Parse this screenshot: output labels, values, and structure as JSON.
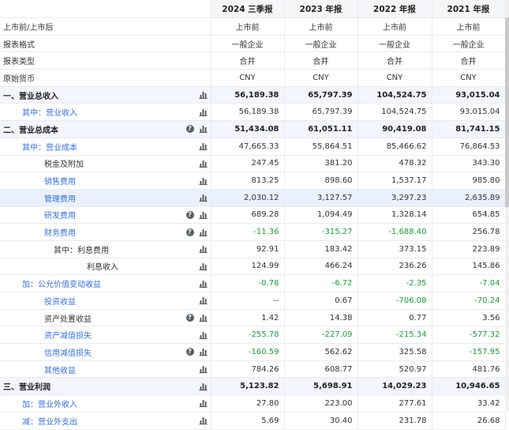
{
  "columns": [
    "2024 三季报",
    "2023 年报",
    "2022 年报",
    "2021 年报"
  ],
  "rows": [
    {
      "label": "上市前/上市后",
      "values": [
        "上市前",
        "上市前",
        "上市前",
        "上市前"
      ],
      "kind": "meta"
    },
    {
      "label": "报表格式",
      "values": [
        "一般企业",
        "一般企业",
        "一般企业",
        "一般企业"
      ],
      "kind": "meta"
    },
    {
      "label": "报表类型",
      "values": [
        "合并",
        "合并",
        "合并",
        "合并"
      ],
      "kind": "meta"
    },
    {
      "label": "原始货币",
      "values": [
        "CNY",
        "CNY",
        "CNY",
        "CNY"
      ],
      "kind": "meta"
    },
    {
      "label": "一、营业总收入",
      "values": [
        "56,189.38",
        "65,797.39",
        "104,524.75",
        "93,015.04"
      ],
      "kind": "bold"
    },
    {
      "label": "其中：营业收入",
      "values": [
        "56,189.38",
        "65,797.39",
        "104,524.75",
        "93,015.04"
      ],
      "kind": "sub1"
    },
    {
      "label": "二、营业总成本",
      "values": [
        "51,434.08",
        "61,051.11",
        "90,419.08",
        "81,741.15"
      ],
      "kind": "bold",
      "q": true
    },
    {
      "label": "其中：营业成本",
      "values": [
        "47,665.33",
        "55,864.51",
        "85,466.62",
        "76,864.53"
      ],
      "kind": "sub1"
    },
    {
      "label": "税金及附加",
      "values": [
        "247.45",
        "381.20",
        "478.32",
        "343.30"
      ],
      "kind": "sub2plain"
    },
    {
      "label": "销售费用",
      "values": [
        "813.25",
        "898.60",
        "1,537.17",
        "985.80"
      ],
      "kind": "sub2"
    },
    {
      "label": "管理费用",
      "values": [
        "2,030.12",
        "3,127.57",
        "3,297.23",
        "2,635.89"
      ],
      "kind": "sub2hl"
    },
    {
      "label": "研发费用",
      "values": [
        "689.28",
        "1,094.49",
        "1,328.14",
        "654.85"
      ],
      "kind": "sub2",
      "q": true
    },
    {
      "label": "财务费用",
      "values": [
        "-11.36",
        "-315.27",
        "-1,688.40",
        "256.78"
      ],
      "kind": "sub2",
      "q": true,
      "green": [
        true,
        true,
        true,
        false
      ]
    },
    {
      "label": "其中：利息费用",
      "values": [
        "92.91",
        "183.42",
        "373.15",
        "223.89"
      ],
      "kind": "sub3"
    },
    {
      "label": "利息收入",
      "values": [
        "124.99",
        "466.24",
        "236.26",
        "145.86"
      ],
      "kind": "sub4"
    },
    {
      "label": "加：公允价值变动收益",
      "values": [
        "-0.78",
        "-6.72",
        "-2.35",
        "-7.04"
      ],
      "kind": "sub1",
      "green": [
        true,
        true,
        true,
        true
      ]
    },
    {
      "label": "投资收益",
      "values": [
        "--",
        "0.67",
        "-706.08",
        "-70.24"
      ],
      "kind": "sub2",
      "green": [
        false,
        false,
        true,
        true
      ]
    },
    {
      "label": "资产处置收益",
      "values": [
        "1.42",
        "14.38",
        "0.77",
        "3.56"
      ],
      "kind": "sub2plain",
      "q": true
    },
    {
      "label": "资产减值损失",
      "values": [
        "-255.78",
        "-227.09",
        "-215.34",
        "-577.32"
      ],
      "kind": "sub2",
      "green": [
        true,
        true,
        true,
        true
      ]
    },
    {
      "label": "信用减值损失",
      "values": [
        "-160.59",
        "562.62",
        "325.58",
        "-157.95"
      ],
      "kind": "sub2",
      "q": true,
      "green": [
        true,
        false,
        false,
        true
      ]
    },
    {
      "label": "其他收益",
      "values": [
        "784.26",
        "608.77",
        "520.97",
        "481.76"
      ],
      "kind": "sub2"
    },
    {
      "label": "三、营业利润",
      "values": [
        "5,123.82",
        "5,698.91",
        "14,029.23",
        "10,946.65"
      ],
      "kind": "bold"
    },
    {
      "label": "加：营业外收入",
      "values": [
        "27.80",
        "223.00",
        "277.61",
        "33.42"
      ],
      "kind": "sub1"
    },
    {
      "label": "减：营业外支出",
      "values": [
        "5.69",
        "30.40",
        "231.78",
        "26.68"
      ],
      "kind": "sub1"
    }
  ]
}
